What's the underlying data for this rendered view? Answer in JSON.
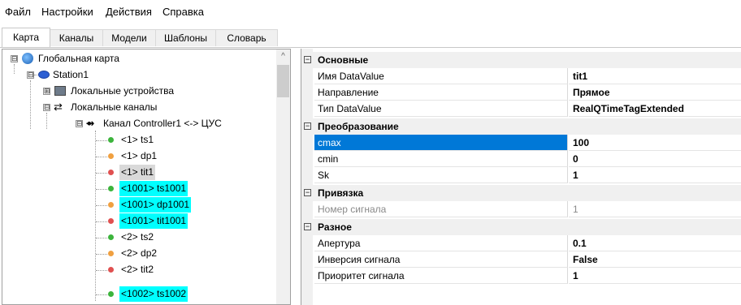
{
  "menu": [
    "Файл",
    "Настройки",
    "Действия",
    "Справка"
  ],
  "tabs": [
    "Карта",
    "Каналы",
    "Модели",
    "Шаблоны",
    "Словарь"
  ],
  "tree": {
    "root": "Глобальная карта",
    "station": "Station1",
    "local_devices": "Локальные устройства",
    "local_channels": "Локальные каналы",
    "channel": "Канал Controller1 <-> ЦУС",
    "items": [
      {
        "label": "<1> ts1",
        "bullet": "#3cb43c",
        "style": "plain"
      },
      {
        "label": "<1> dp1",
        "bullet": "#f0a040",
        "style": "plain"
      },
      {
        "label": "<1> tit1",
        "bullet": "#e05050",
        "style": "selected"
      },
      {
        "label": "<1001> ts1001",
        "bullet": "#3cb43c",
        "style": "highlight"
      },
      {
        "label": "<1001> dp1001",
        "bullet": "#f0a040",
        "style": "highlight"
      },
      {
        "label": "<1001> tit1001",
        "bullet": "#e05050",
        "style": "highlight"
      },
      {
        "label": "<2> ts2",
        "bullet": "#3cb43c",
        "style": "plain"
      },
      {
        "label": "<2> dp2",
        "bullet": "#f0a040",
        "style": "plain"
      },
      {
        "label": "<2> tit2",
        "bullet": "#e05050",
        "style": "plain"
      },
      {
        "label": "<1002> ts1002",
        "bullet": "#3cb43c",
        "style": "highlight"
      }
    ]
  },
  "properties": {
    "basic": {
      "title": "Основные",
      "rows": [
        {
          "name": "Имя DataValue",
          "value": "tit1"
        },
        {
          "name": "Направление",
          "value": "Прямое"
        },
        {
          "name": "Тип DataValue",
          "value": "RealQTimeTagExtended"
        }
      ]
    },
    "transform": {
      "title": "Преобразование",
      "rows": [
        {
          "name": "cmax",
          "value": "100"
        },
        {
          "name": "cmin",
          "value": "0"
        },
        {
          "name": "Sk",
          "value": "1"
        }
      ]
    },
    "binding": {
      "title": "Привязка",
      "rows": [
        {
          "name": "Номер сигнала",
          "value": "1"
        }
      ]
    },
    "misc": {
      "title": "Разное",
      "rows": [
        {
          "name": "Апертура",
          "value": "0.1"
        },
        {
          "name": "Инверсия сигнала",
          "value": "False"
        },
        {
          "name": "Приоритет сигнала",
          "value": "1"
        }
      ]
    }
  },
  "icons": {
    "toggle_expanded": "⊟",
    "toggle_collapsed": "⊞",
    "scroll_up": "^"
  },
  "colors": {
    "selection_blue": "#0078d7",
    "highlight_cyan": "#00ffff"
  }
}
